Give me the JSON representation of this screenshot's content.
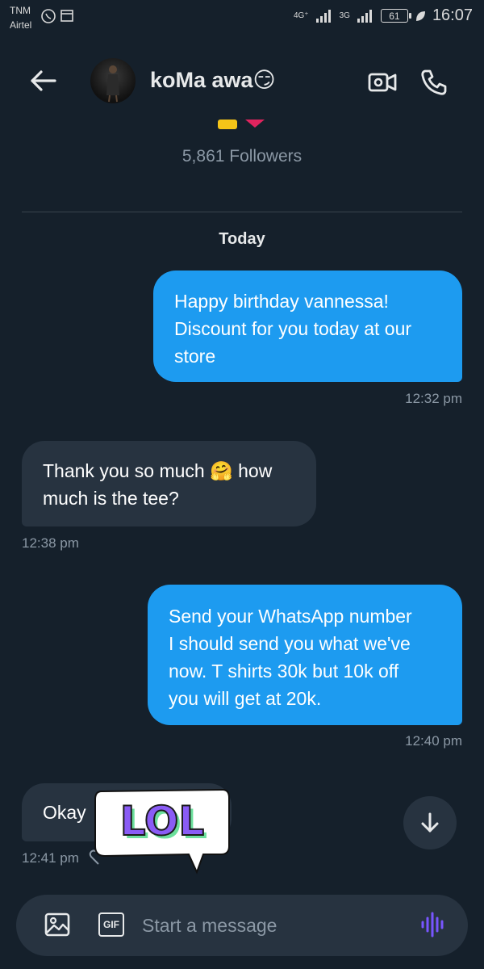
{
  "status_bar": {
    "carrier_top": "TNM",
    "carrier_bottom": "Airtel",
    "network_1": "4G⁺",
    "network_2": "3G",
    "battery": "61",
    "time": "16:07"
  },
  "header": {
    "title": "koMa awa😏",
    "back_icon": "arrow-left-icon",
    "video_icon": "video-call-icon",
    "phone_icon": "phone-call-icon"
  },
  "profile": {
    "followers": "5,861 Followers"
  },
  "conversation": {
    "date_label": "Today",
    "messages": [
      {
        "direction": "out",
        "lines": [
          "Happy birthday vannessa!",
          "Discount for you today at our",
          "store"
        ],
        "time": "12:32 pm"
      },
      {
        "direction": "in",
        "lines": [
          "Thank you so much 🤗 how",
          "much is the tee?"
        ],
        "time": "12:38 pm"
      },
      {
        "direction": "out",
        "lines": [
          "Send your WhatsApp number",
          "I should send you what we've",
          "now. T shirts 30k but 10k off",
          "you will get at 20k."
        ],
        "time": "12:40 pm"
      },
      {
        "direction": "in",
        "lines": [
          "Okay"
        ],
        "time": "12:41 pm"
      }
    ],
    "sticker_text": "LOL"
  },
  "composer": {
    "placeholder": "Start a message",
    "gif_label": "GIF"
  },
  "colors": {
    "background": "#15202b",
    "outgoing_bubble": "#1d9bf0",
    "incoming_bubble": "#273340",
    "secondary_text": "#8b98a5",
    "voice_accent": "#7856ff"
  }
}
